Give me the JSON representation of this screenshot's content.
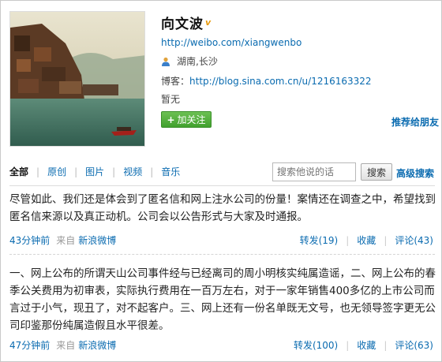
{
  "profile": {
    "name": "向文波",
    "verified_badge": "v",
    "weibo_url": "http://weibo.com/xiangwenbo",
    "location": "湖南,长沙",
    "blog_label": "博客：",
    "blog_url": "http://blog.sina.com.cn/u/1216163322",
    "bio": "暂无",
    "follow_label": "加关注",
    "recommend_label": "推荐给朋友"
  },
  "tabs": [
    "全部",
    "原创",
    "图片",
    "视频",
    "音乐"
  ],
  "search": {
    "placeholder": "搜索他说的话",
    "button_label": "搜索",
    "advanced_label": "高级搜索"
  },
  "posts": [
    {
      "text": "尽管如此、我们还是体会到了匿名信和网上注水公司的份量！案情还在调查之中，希望找到匿名信来源以及真正动机。公司会以公告形式与大家及时通报。",
      "time": "43分钟前",
      "from_label": "来自",
      "source": "新浪微博",
      "forward": "转发(19)",
      "favorite": "收藏",
      "comment": "评论(43)"
    },
    {
      "text": "一、网上公布的所谓天山公司事件经与已经离司的周小明核实纯属造谣，二、网上公布的春季公关费用为初审表，实际执行费用在一百万左右，对于一家年销售400多亿的上市公司而言过于小气，现丑了，对不起客户。三、网上还有一份名单既无文号，也无领导签字更无公司印鉴那份纯属造假且水平很差。",
      "time": "47分钟前",
      "from_label": "来自",
      "source": "新浪微博",
      "forward": "转发(100)",
      "favorite": "收藏",
      "comment": "评论(63)"
    }
  ],
  "colors": {
    "link": "#0a6bb0",
    "follow_button": "#4caf3a",
    "verified": "#e89a0c"
  }
}
